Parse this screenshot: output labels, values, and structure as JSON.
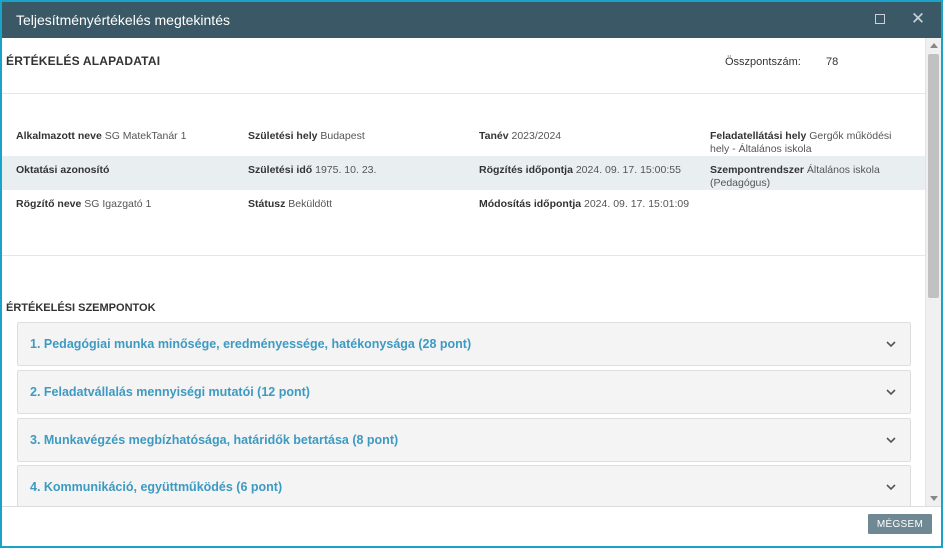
{
  "window": {
    "title": "Teljesítményértékelés megtekintés"
  },
  "basic": {
    "heading": "ÉRTÉKELÉS ALAPADATAI",
    "total_label": "Összpontszám:",
    "total_value": "78",
    "rows": [
      [
        {
          "label": "Alkalmazott neve",
          "value": "SG MatekTanár 1"
        },
        {
          "label": "Születési hely",
          "value": "Budapest"
        },
        {
          "label": "Tanév",
          "value": "2023/2024"
        },
        {
          "label": "Feladatellátási hely",
          "value": "Gergők működési hely - Általános iskola"
        }
      ],
      [
        {
          "label": "Oktatási azonosító",
          "value": ""
        },
        {
          "label": "Születési idő",
          "value": "1975. 10. 23."
        },
        {
          "label": "Rögzítés időpontja",
          "value": "2024. 09. 17. 15:00:55"
        },
        {
          "label": "Szempontrendszer",
          "value": "Általános iskola (Pedagógus)"
        }
      ],
      [
        {
          "label": "Rögzítő neve",
          "value": "SG Igazgató 1"
        },
        {
          "label": "Státusz",
          "value": "Beküldött"
        },
        {
          "label": "Módosítás időpontja",
          "value": "2024. 09. 17. 15:01:09"
        },
        {
          "label": "",
          "value": ""
        }
      ]
    ]
  },
  "criteria": {
    "heading": "ÉRTÉKELÉSI SZEMPONTOK",
    "items": [
      {
        "label": "1. Pedagógiai munka minősége, eredményessége, hatékonysága (28 pont)"
      },
      {
        "label": "2. Feladatvállalás mennyiségi mutatói (12 pont)"
      },
      {
        "label": "3. Munkavégzés megbízhatósága, határidők betartása (8 pont)"
      },
      {
        "label": "4. Kommunikáció, együttműködés (6 pont)"
      }
    ]
  },
  "footer": {
    "cancel_label": "MÉGSEM"
  },
  "colors": {
    "titlebar": "#3b5866",
    "border": "#1aa3c8",
    "accordion_text": "#3d9ac2",
    "button": "#6f8893"
  }
}
